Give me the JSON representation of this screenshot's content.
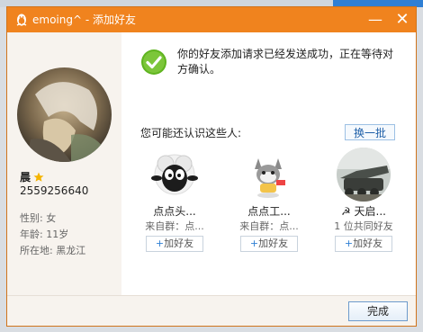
{
  "window": {
    "title": "emoing^ - 添加好友",
    "minimize_glyph": "—",
    "close_glyph": "✕"
  },
  "profile": {
    "nickname": "晨",
    "qq_number": "2559256640",
    "gender": "性别: 女",
    "age": "年龄: 11岁",
    "location": "所在地:  黑龙江"
  },
  "status": {
    "message": "你的好友添加请求已经发送成功，正在等待对方确认。"
  },
  "suggestions": {
    "label": "您可能还认识这些人:",
    "refresh_label": "换一批",
    "people": [
      {
        "name": "点点头...",
        "sub": "来自群：点...",
        "add_label": "加好友"
      },
      {
        "name": "点点工...",
        "sub": "来自群：点...",
        "add_label": "加好友"
      },
      {
        "name": "☭ 天启...",
        "sub": "1 位共同好友",
        "add_label": "加好友"
      }
    ]
  },
  "footer": {
    "done_label": "完成"
  },
  "colors": {
    "titlebar": "#f0831e",
    "sidebar": "#f7f3ee",
    "link": "#1e5fa8"
  }
}
